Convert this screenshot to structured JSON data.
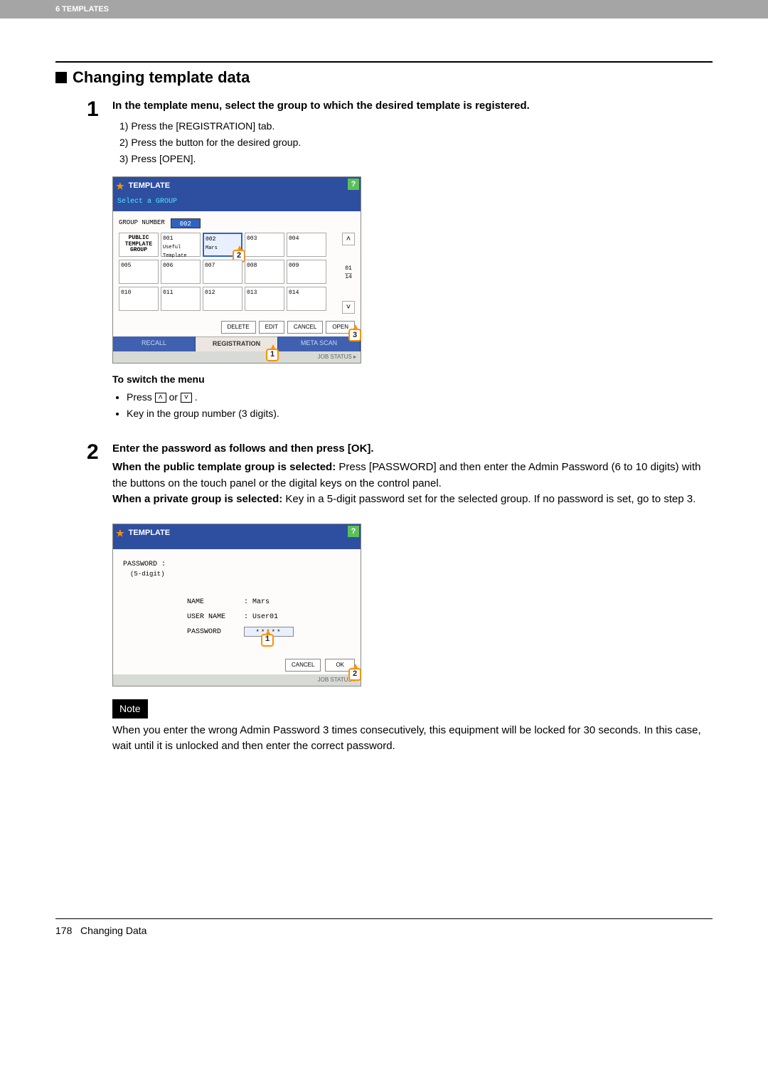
{
  "header": {
    "chapter": "6 TEMPLATES"
  },
  "section_title": "Changing template data",
  "step1": {
    "num": "1",
    "title": "In the template menu, select the group to which the desired template is registered.",
    "items": [
      "1)  Press the [REGISTRATION] tab.",
      "2)  Press the button for the desired group.",
      "3)  Press [OPEN]."
    ],
    "switch_title": "To switch the menu",
    "switch_bullets": {
      "b1_pre": "Press ",
      "b1_mid": " or ",
      "b1_post": " .",
      "b2": "Key in the group number (3 digits)."
    }
  },
  "screenshot1": {
    "title": "TEMPLATE",
    "subtitle": "Select a GROUP",
    "group_number_label": "GROUP NUMBER",
    "group_number_value": "002",
    "public_label": "PUBLIC\nTEMPLATE\nGROUP",
    "cells": [
      [
        "001",
        "Useful Template"
      ],
      [
        "002",
        "Mars"
      ],
      [
        "003",
        ""
      ],
      [
        "004",
        ""
      ],
      [
        "005",
        ""
      ],
      [
        "006",
        ""
      ],
      [
        "007",
        ""
      ],
      [
        "008",
        ""
      ],
      [
        "009",
        ""
      ],
      [
        "010",
        ""
      ],
      [
        "011",
        ""
      ],
      [
        "012",
        ""
      ],
      [
        "013",
        ""
      ],
      [
        "014",
        ""
      ]
    ],
    "page_indicator_top": "01",
    "page_indicator_bottom": "14",
    "buttons": {
      "delete": "DELETE",
      "edit": "EDIT",
      "cancel": "CANCEL",
      "open": "OPEN"
    },
    "tabs": {
      "recall": "RECALL",
      "registration": "REGISTRATION",
      "metascan": "META SCAN"
    },
    "jobstatus": "JOB STATUS",
    "callouts": {
      "c1": "1",
      "c2": "2",
      "c3": "3"
    }
  },
  "step2": {
    "num": "2",
    "title": "Enter the password as follows and then press [OK].",
    "public_prefix": "When the public template group is selected:",
    "public_body": " Press [PASSWORD] and then enter the Admin Password (6 to 10 digits) with the buttons on the touch panel or the digital keys on the control panel.",
    "private_prefix": "When a private group is selected:",
    "private_body": " Key in a 5-digit password set for the selected group. If no password is set, go to step 3."
  },
  "screenshot2": {
    "title": "TEMPLATE",
    "pw_label": "PASSWORD :",
    "pw_sub": "(5-digit)",
    "name_lbl": "NAME",
    "name_val": ": Mars",
    "user_lbl": "USER NAME",
    "user_val": ": User01",
    "pass_lbl": "PASSWORD",
    "pass_val": "*****",
    "buttons": {
      "cancel": "CANCEL",
      "ok": "OK"
    },
    "jobstatus": "JOB STATUS",
    "callouts": {
      "c1": "1",
      "c2": "2"
    }
  },
  "note": {
    "label": "Note",
    "text": "When you enter the wrong Admin Password 3 times consecutively, this equipment will be locked for 30 seconds. In this case, wait until it is unlocked and then enter the correct password."
  },
  "footer": {
    "page": "178",
    "title": "Changing Data"
  }
}
